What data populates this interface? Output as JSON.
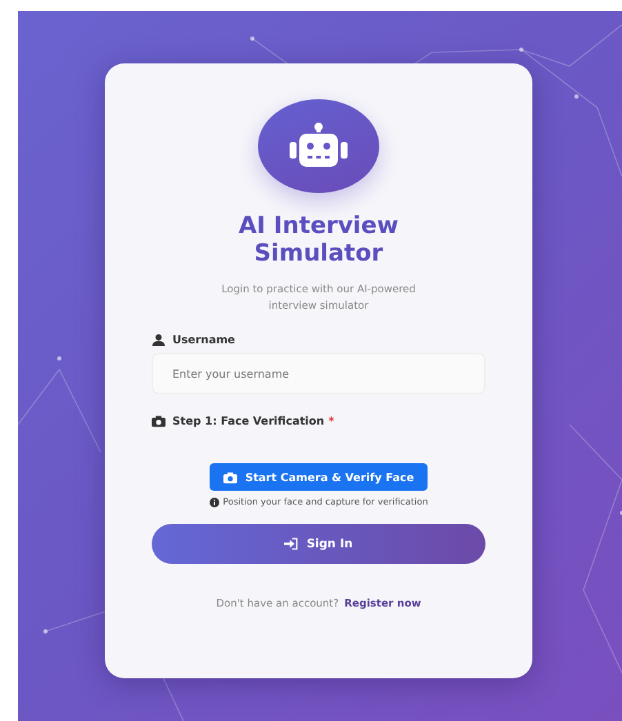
{
  "card": {
    "title": "AI Interview Simulator",
    "subtitle": "Login to practice with our AI-powered interview simulator",
    "username": {
      "label": "Username",
      "placeholder": "Enter your username"
    },
    "face_step": {
      "label": "Step 1: Face Verification",
      "required_mark": "*"
    },
    "camera_button": "Start Camera & Verify Face",
    "hint": "Position your face and capture for verification",
    "sign_in_button": "Sign In",
    "register": {
      "prompt": "Don't have an account?",
      "link": "Register now"
    }
  }
}
